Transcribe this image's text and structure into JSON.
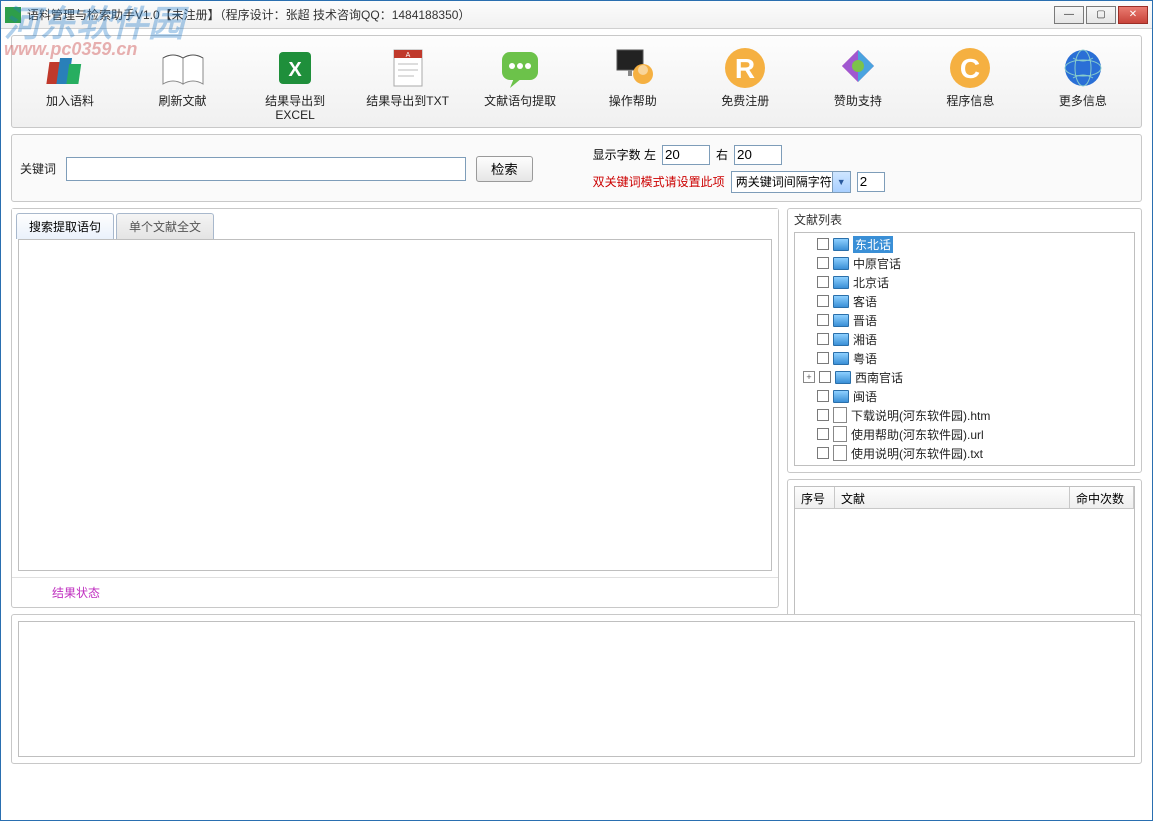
{
  "window": {
    "title": "语料管理与检索助手V1.0【未注册】（程序设计：张超  技术咨询QQ：1484188350）"
  },
  "watermark": {
    "main": "河东软件园",
    "sub": "www.pc0359.cn"
  },
  "toolbar": [
    {
      "label": "加入语料",
      "icon": "books-icon"
    },
    {
      "label": "刷新文献",
      "icon": "open-book-icon"
    },
    {
      "label": "结果导出到\nEXCEL",
      "icon": "excel-icon"
    },
    {
      "label": "结果导出到TXT",
      "icon": "txt-icon"
    },
    {
      "label": "文献语句提取",
      "icon": "speech-bubble-icon"
    },
    {
      "label": "操作帮助",
      "icon": "help-person-icon"
    },
    {
      "label": "免费注册",
      "icon": "register-icon"
    },
    {
      "label": "赞助支持",
      "icon": "support-icon"
    },
    {
      "label": "程序信息",
      "icon": "info-icon"
    },
    {
      "label": "更多信息",
      "icon": "globe-icon"
    }
  ],
  "search": {
    "keyword_label": "关键词",
    "keyword_value": "",
    "search_btn": "检索",
    "display_char_label": "显示字数 左",
    "left_value": "20",
    "right_label": "右",
    "right_value": "20",
    "dual_mode_label": "双关键词模式请设置此项",
    "separator_select": "两关键词间隔字符数",
    "separator_value": "2"
  },
  "tabs": {
    "t1": "搜索提取语句",
    "t2": "单个文献全文"
  },
  "status": "结果状态",
  "doclist": {
    "title": "文献列表",
    "items": [
      {
        "label": "东北话",
        "type": "folder",
        "selected": true
      },
      {
        "label": "中原官话",
        "type": "folder"
      },
      {
        "label": "北京话",
        "type": "folder"
      },
      {
        "label": "客语",
        "type": "folder"
      },
      {
        "label": "晋语",
        "type": "folder"
      },
      {
        "label": "湘语",
        "type": "folder"
      },
      {
        "label": "粤语",
        "type": "folder"
      },
      {
        "label": "西南官话",
        "type": "folder",
        "expandable": true
      },
      {
        "label": "闽语",
        "type": "folder"
      },
      {
        "label": "下载说明(河东软件园).htm",
        "type": "file"
      },
      {
        "label": "使用帮助(河东软件园).url",
        "type": "file"
      },
      {
        "label": "使用说明(河东软件园).txt",
        "type": "file"
      }
    ]
  },
  "grid": {
    "col1": "序号",
    "col2": "文献",
    "col3": "命中次数"
  }
}
